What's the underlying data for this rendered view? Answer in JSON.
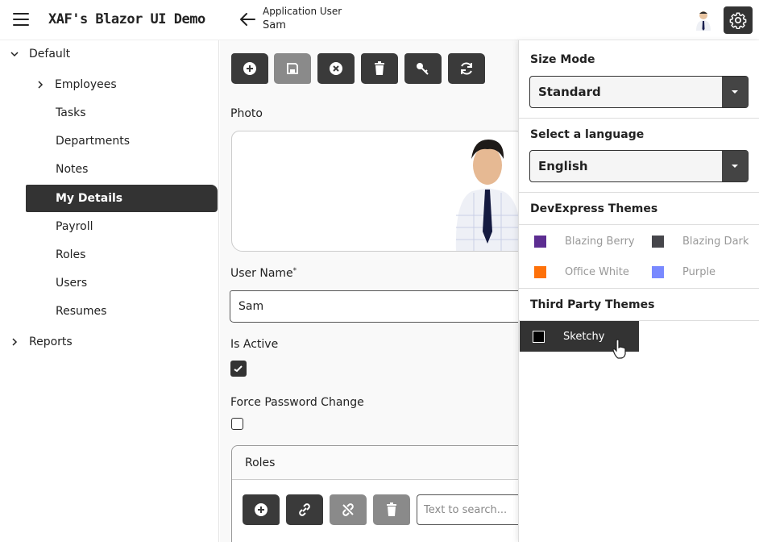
{
  "header": {
    "app_title": "XAF's Blazor UI Demo",
    "view_caption": "Application User",
    "view_subtitle": "Sam"
  },
  "sidebar": {
    "items": [
      {
        "label": "Default",
        "chevron": "down"
      },
      {
        "label": "Employees",
        "chevron": "right"
      },
      {
        "label": "Tasks"
      },
      {
        "label": "Departments"
      },
      {
        "label": "Notes"
      },
      {
        "label": "My Details",
        "active": true
      },
      {
        "label": "Payroll"
      },
      {
        "label": "Roles"
      },
      {
        "label": "Users"
      },
      {
        "label": "Resumes"
      },
      {
        "label": "Reports",
        "chevron": "right"
      }
    ]
  },
  "toolbar": {
    "icons": [
      "plus-icon",
      "save-icon",
      "close-icon",
      "delete-icon",
      "reset-password-icon",
      "refresh-icon"
    ]
  },
  "form": {
    "photo_label": "Photo",
    "username_label": "User Name",
    "username_required_mark": "*",
    "username_value": "Sam",
    "is_active_label": "Is Active",
    "is_active_value": true,
    "force_password_label": "Force Password Change",
    "force_password_value": false
  },
  "roles": {
    "title": "Roles",
    "search_placeholder": "Text to search..."
  },
  "settings": {
    "size_mode_title": "Size Mode",
    "size_mode_value": "Standard",
    "language_title": "Select a language",
    "language_value": "English",
    "devexpress_title": "DevExpress Themes",
    "devexpress_themes": [
      {
        "label": "Blazing Berry",
        "color": "#5c2d91"
      },
      {
        "label": "Blazing Dark",
        "color": "#46464b"
      },
      {
        "label": "Office White",
        "color": "#fe7109"
      },
      {
        "label": "Purple",
        "color": "#7989ff"
      }
    ],
    "third_party_title": "Third Party Themes",
    "third_party_themes": [
      {
        "label": "Sketchy",
        "color": "#000000",
        "active": true
      }
    ]
  }
}
